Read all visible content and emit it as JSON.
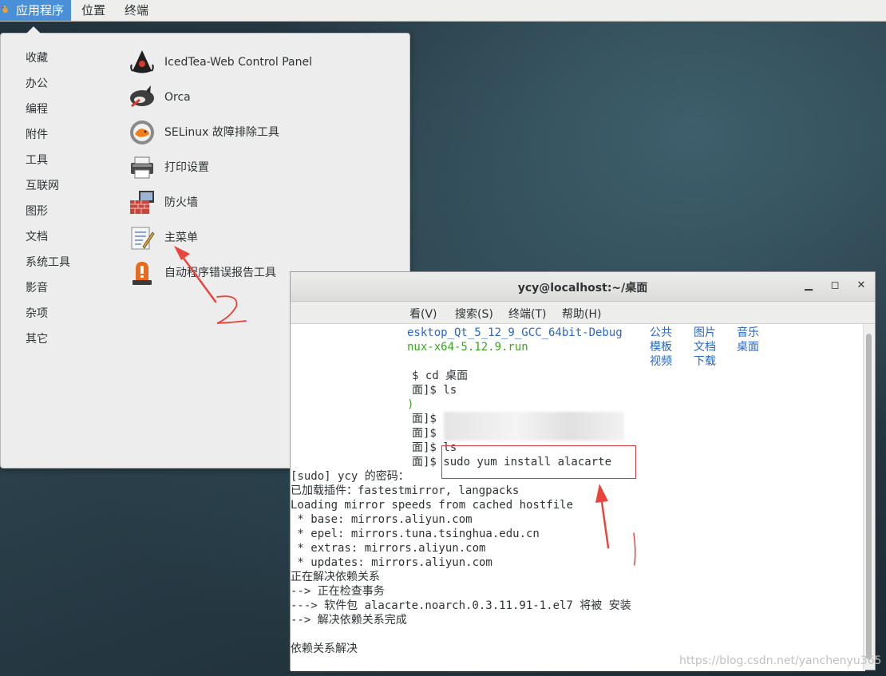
{
  "topbar": {
    "apps": "应用程序",
    "places": "位置",
    "terminal": "终端"
  },
  "menu": {
    "categories": [
      "收藏",
      "办公",
      "编程",
      "附件",
      "工具",
      "互联网",
      "图形",
      "文档",
      "系统工具",
      "影音",
      "杂项",
      "其它"
    ],
    "apps": [
      {
        "name": "IcedTea-Web Control Panel",
        "icon": "icedtea-duke-icon"
      },
      {
        "name": "Orca",
        "icon": "orca-icon"
      },
      {
        "name": "SELinux 故障排除工具",
        "icon": "selinux-troubleshooter-icon"
      },
      {
        "name": "打印设置",
        "icon": "printer-icon"
      },
      {
        "name": "防火墙",
        "icon": "firewall-icon"
      },
      {
        "name": "主菜单",
        "icon": "main-menu-editor-icon"
      },
      {
        "name": "自动程序错误报告工具",
        "icon": "alert-beacon-icon"
      }
    ]
  },
  "terminal": {
    "title": "ycy@localhost:~/桌面",
    "menus": [
      "看(V)",
      "搜索(S)",
      "终端(T)",
      "帮助(H)"
    ],
    "ls_left": [
      "esktop_Qt_5_12_9_GCC_64bit-Debug",
      "nux-x64-5.12.9.run"
    ],
    "ls_dirs": [
      [
        "公共",
        "图片",
        "音乐"
      ],
      [
        "模板",
        "文档",
        "桌面"
      ],
      [
        "视频",
        "下载"
      ]
    ],
    "lines": [
      "$ cd 桌面",
      "面]$ ls",
      "面]$",
      "面]$",
      "面]$ ls",
      "面]$ sudo yum install alacarte",
      "[sudo] ycy 的密码：",
      "已加载插件：fastestmirror, langpacks",
      "Loading mirror speeds from cached hostfile",
      " * base: mirrors.aliyun.com",
      " * epel: mirrors.tuna.tsinghua.edu.cn",
      " * extras: mirrors.aliyun.com",
      " * updates: mirrors.aliyun.com",
      "正在解决依赖关系",
      "--> 正在检查事务",
      "---> 软件包 alacarte.noarch.0.3.11.91-1.el7 将被 安装",
      "--> 解决依赖关系完成",
      "",
      "依赖关系解决"
    ],
    "green_fragment": ")"
  },
  "watermark": "https://blog.csdn.net/yanchenyu365",
  "colors": {
    "accent": "#4a90d9",
    "annotation": "#e8453c",
    "link_blue": "#2a67c7",
    "green": "#37a81c"
  }
}
